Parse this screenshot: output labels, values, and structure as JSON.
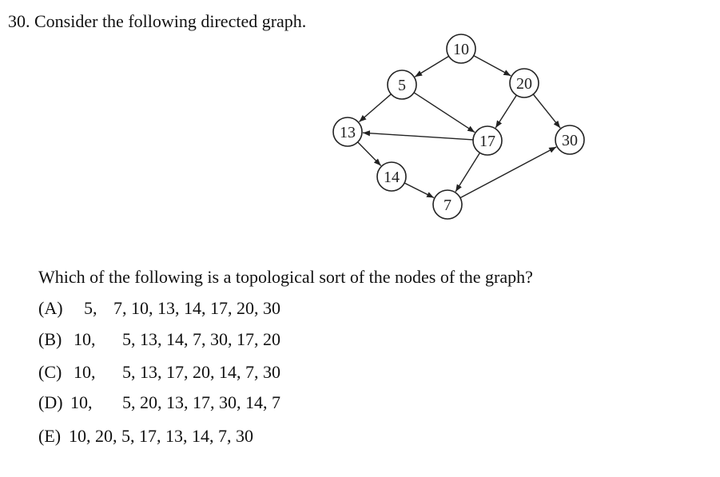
{
  "question": {
    "title": "30. Consider the following directed graph.",
    "prompt": "Which of the following is a topological sort of the nodes of the graph?"
  },
  "graph": {
    "nodes": [
      {
        "id": "n10",
        "label": "10"
      },
      {
        "id": "n5",
        "label": "5"
      },
      {
        "id": "n20",
        "label": "20"
      },
      {
        "id": "n13",
        "label": "13"
      },
      {
        "id": "n17",
        "label": "17"
      },
      {
        "id": "n30",
        "label": "30"
      },
      {
        "id": "n14",
        "label": "14"
      },
      {
        "id": "n7",
        "label": "7"
      }
    ],
    "edges": [
      {
        "from": "10",
        "to": "5"
      },
      {
        "from": "10",
        "to": "20"
      },
      {
        "from": "5",
        "to": "13"
      },
      {
        "from": "5",
        "to": "17"
      },
      {
        "from": "20",
        "to": "17"
      },
      {
        "from": "20",
        "to": "30"
      },
      {
        "from": "17",
        "to": "13"
      },
      {
        "from": "17",
        "to": "7"
      },
      {
        "from": "13",
        "to": "14"
      },
      {
        "from": "14",
        "to": "7"
      },
      {
        "from": "7",
        "to": "30"
      }
    ]
  },
  "options": {
    "a": {
      "letter": "(A)",
      "first": "5,",
      "rest": "7, 10, 13, 14, 17, 20, 30"
    },
    "b": {
      "letter": "(B)",
      "first": "10,",
      "rest": "5, 13, 14, 7, 30, 17, 20"
    },
    "c": {
      "letter": "(C)",
      "first": "10,",
      "rest": "5, 13, 17, 20, 14, 7, 30"
    },
    "d": {
      "letter": "(D)",
      "first": "10,",
      "rest": "5, 20, 13, 17, 30, 14, 7"
    },
    "e": {
      "letter": "(E)",
      "first": "10, 20, 5, 17, 13, 14, 7, 30",
      "rest": ""
    }
  }
}
